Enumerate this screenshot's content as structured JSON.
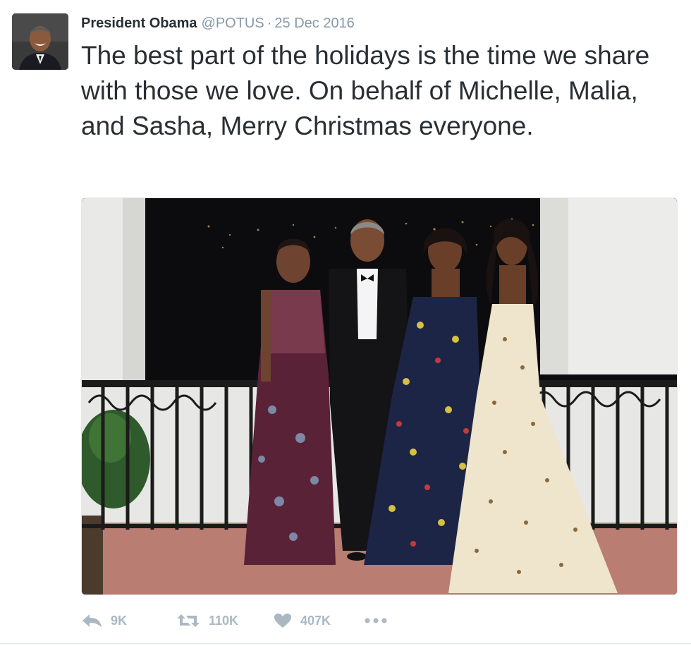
{
  "tweet": {
    "author_name": "President Obama",
    "handle": "@POTUS",
    "separator": "·",
    "date": "25 Dec 2016",
    "text": "The best part of the holidays is the time we share with those we love. On behalf of Michelle, Malia, and Sasha, Merry Christmas everyone."
  },
  "actions": {
    "reply_count": "9K",
    "retweet_count": "110K",
    "like_count": "407K"
  },
  "icons": {
    "reply": "reply-icon",
    "retweet": "retweet-icon",
    "like": "heart-icon",
    "more": "more-dots-icon"
  },
  "colors": {
    "text": "#292f33",
    "secondary": "#8899a6",
    "action": "#aab8c2"
  }
}
